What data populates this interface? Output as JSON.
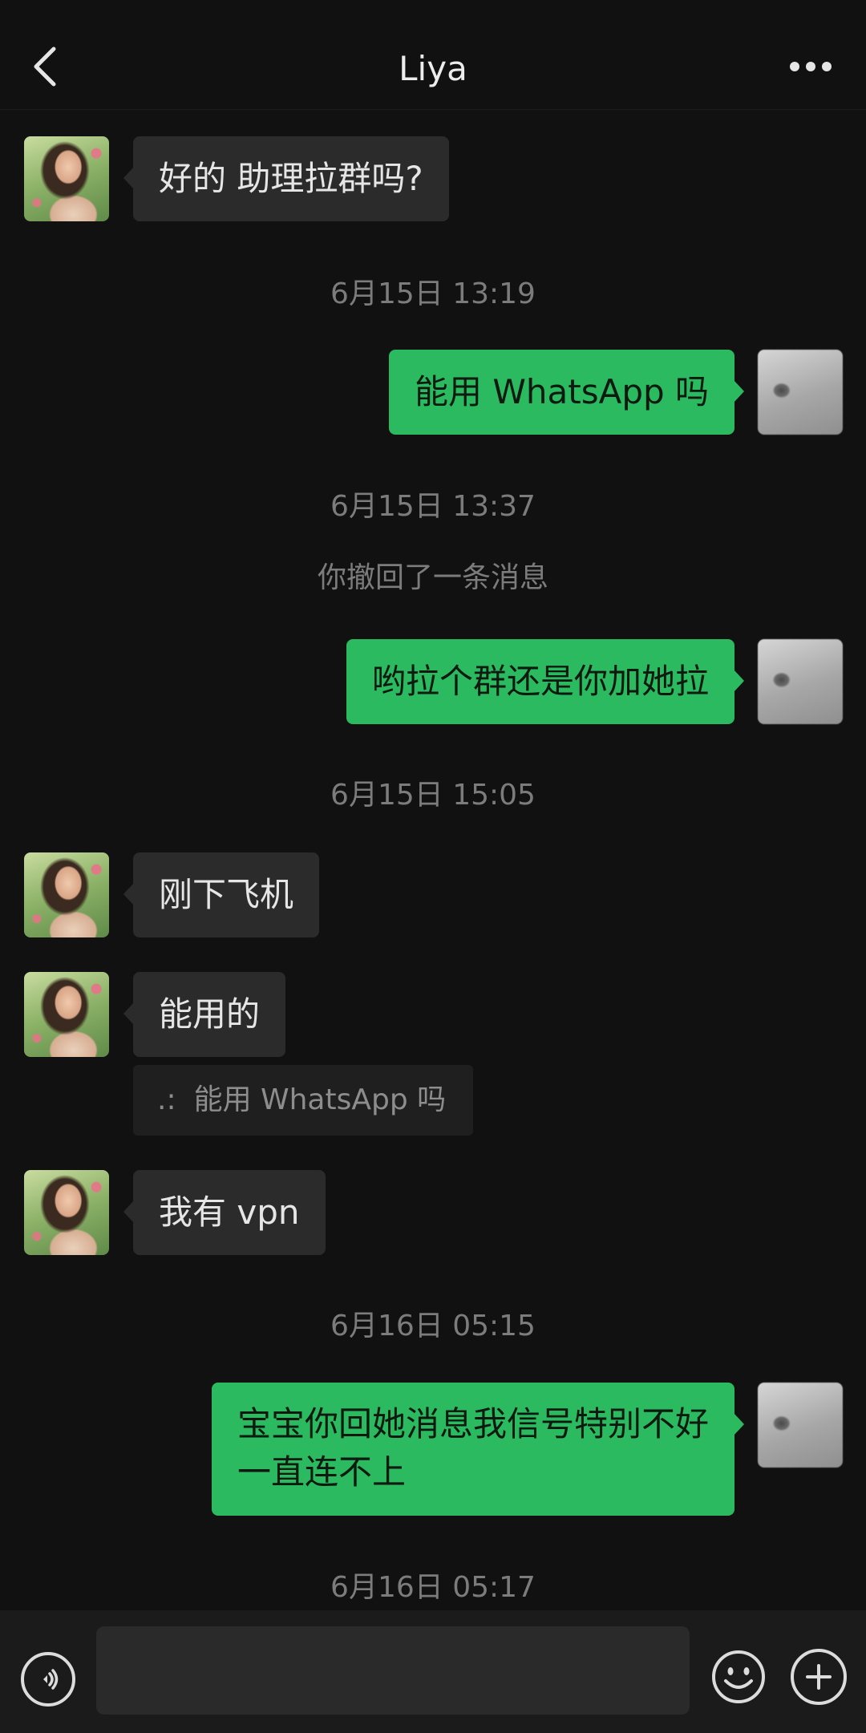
{
  "header": {
    "title": "Liya",
    "back_icon": "chevron-left-icon",
    "more_icon": "more-dots-icon"
  },
  "colors": {
    "background": "#111111",
    "incoming_bubble": "#2b2b2b",
    "outgoing_bubble": "#2bba5f",
    "meta_text": "#7c7c7c"
  },
  "messages": [
    {
      "kind": "incoming",
      "text": "好的 助理拉群吗?"
    },
    {
      "kind": "timestamp",
      "text": "6月15日 13:19"
    },
    {
      "kind": "outgoing",
      "text": "能用 WhatsApp 吗"
    },
    {
      "kind": "timestamp",
      "text": "6月15日 13:37"
    },
    {
      "kind": "system",
      "text": "你撤回了一条消息"
    },
    {
      "kind": "outgoing",
      "text": "哟拉个群还是你加她拉"
    },
    {
      "kind": "timestamp",
      "text": "6月15日 15:05"
    },
    {
      "kind": "incoming",
      "text": "刚下飞机"
    },
    {
      "kind": "incoming",
      "text": "能用的",
      "quote": {
        "mark": ".:",
        "text": "能用 WhatsApp 吗"
      }
    },
    {
      "kind": "incoming",
      "text": "我有 vpn"
    },
    {
      "kind": "timestamp",
      "text": "6月16日 05:15"
    },
    {
      "kind": "outgoing",
      "lines": [
        "宝宝你回她消息我信号特别不好",
        "一直连不上"
      ]
    },
    {
      "kind": "timestamp",
      "text": "6月16日 05:17"
    }
  ],
  "input_bar": {
    "voice_icon": "voice-wave-icon",
    "input_value": "",
    "emoji_icon": "emoji-face-icon",
    "plus_icon": "plus-circle-icon"
  }
}
